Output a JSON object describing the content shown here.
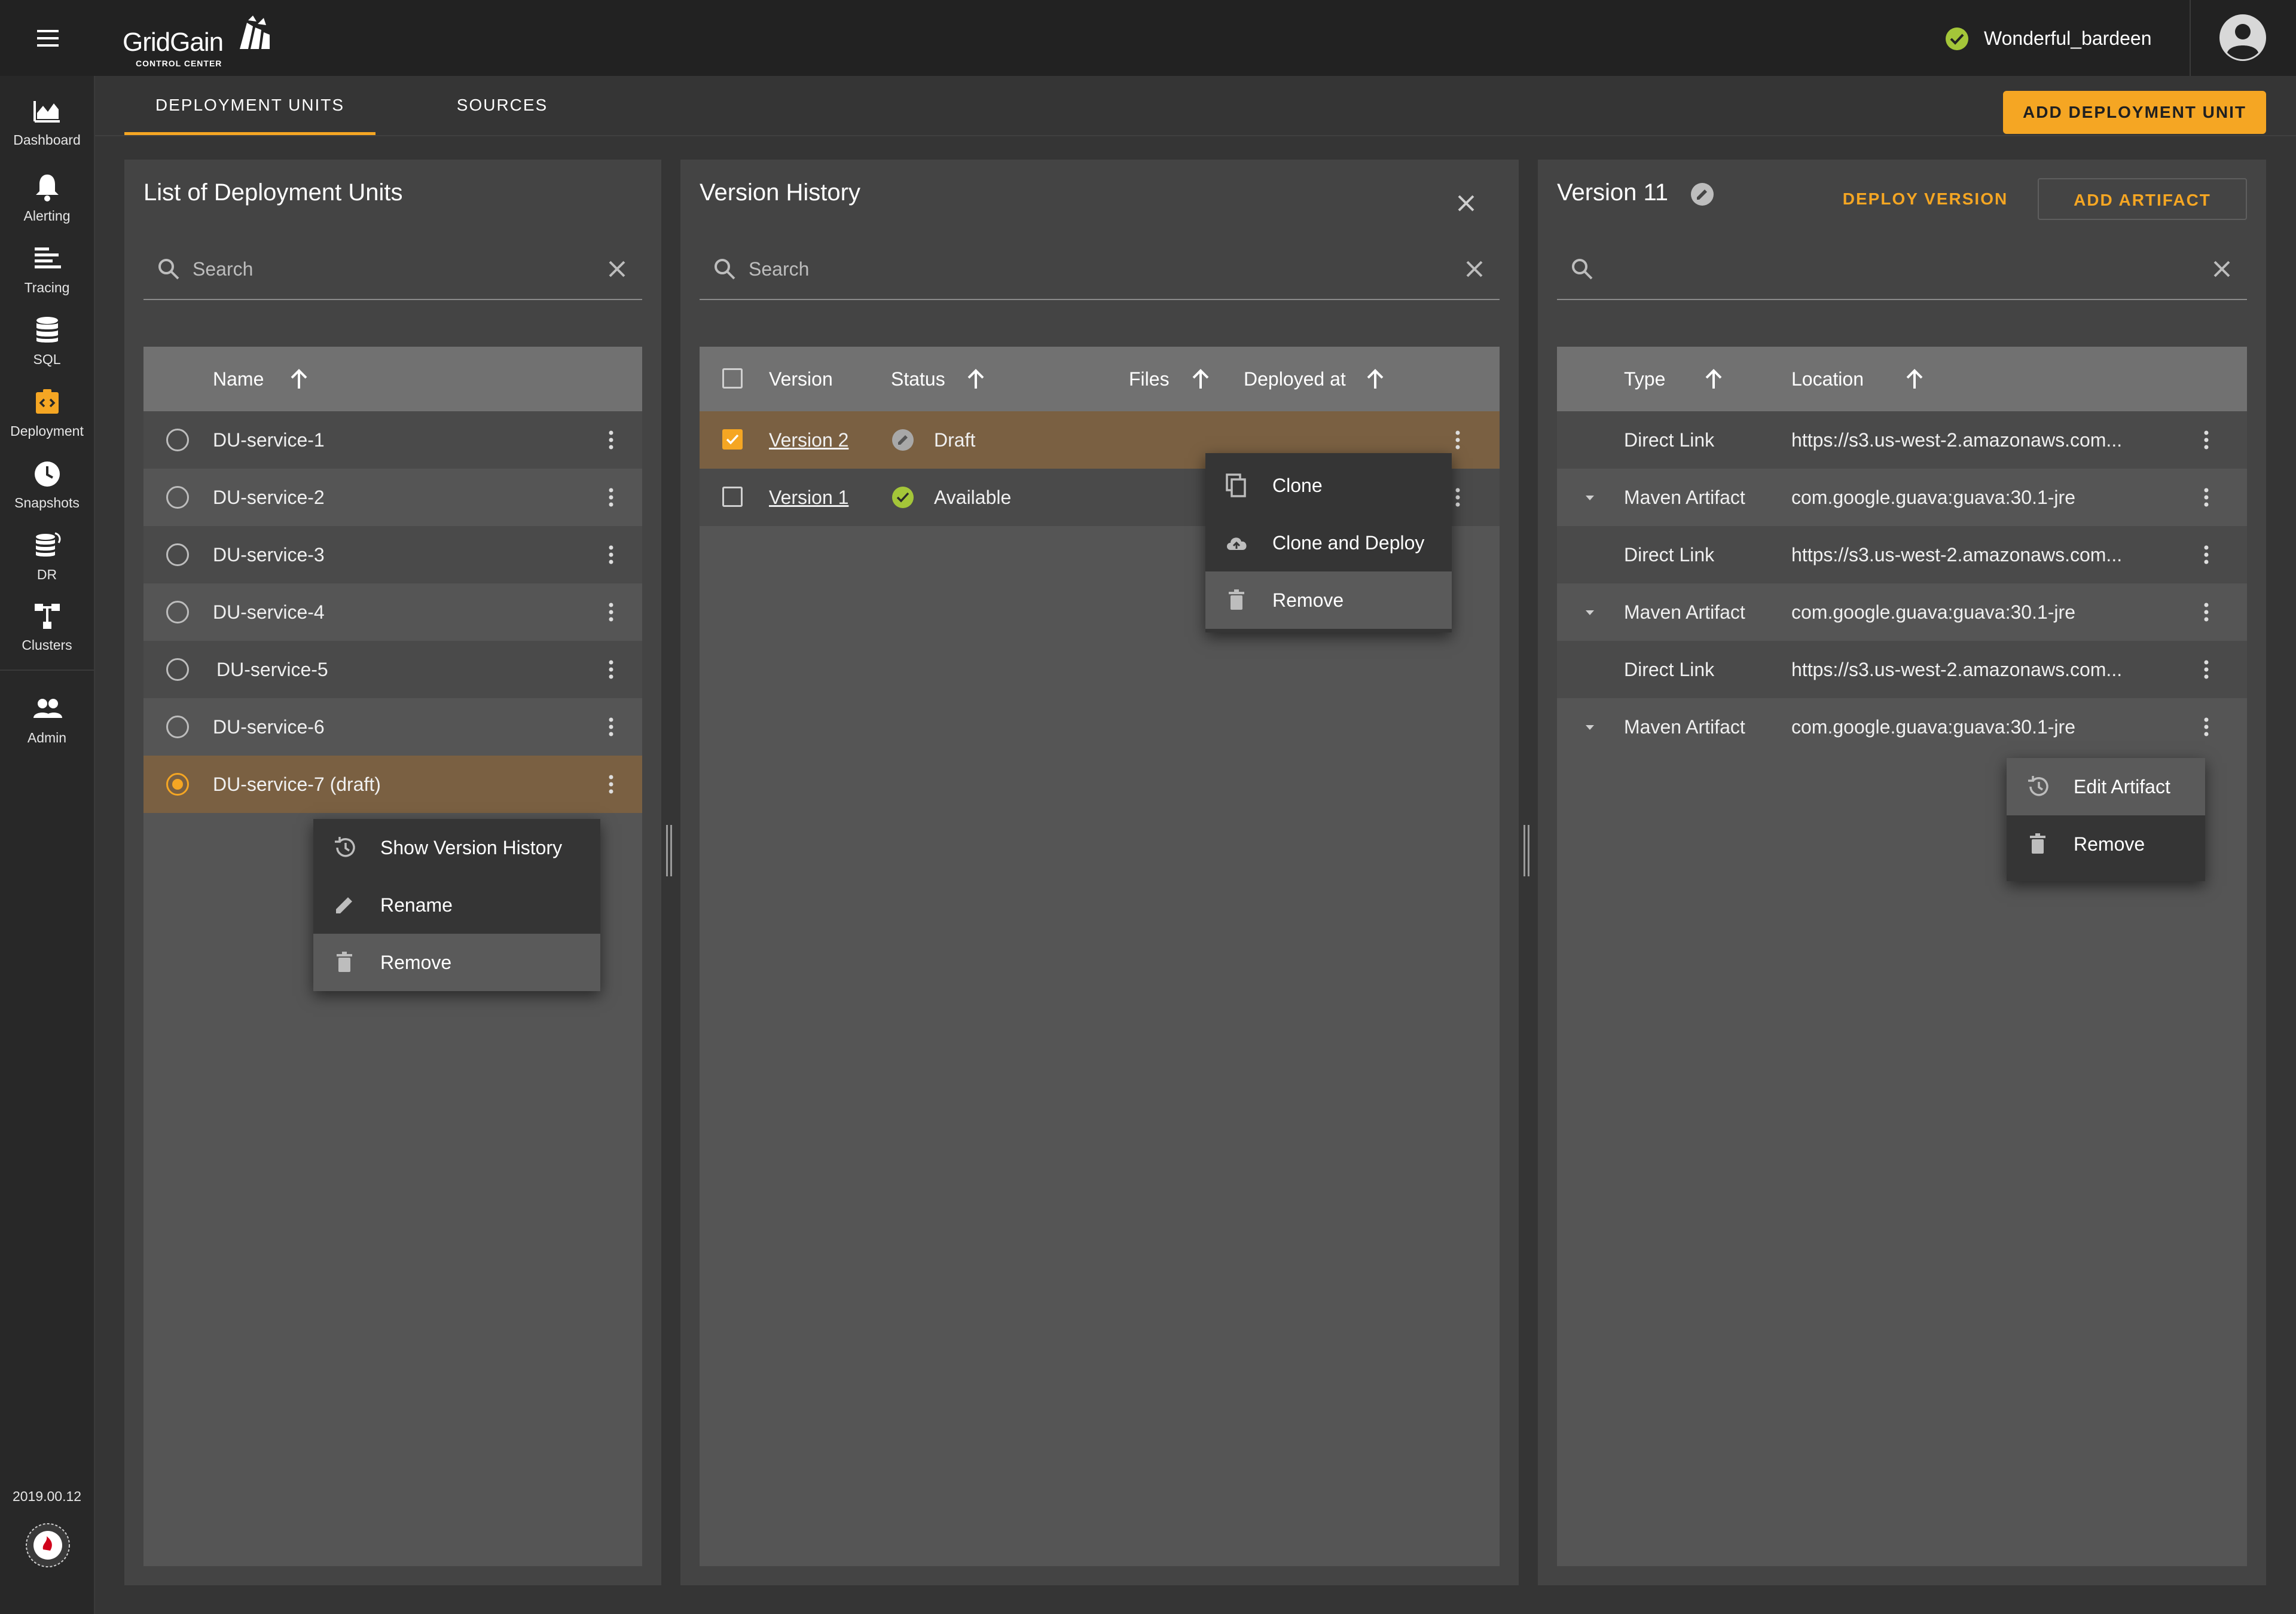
{
  "app": {
    "logo": "GridGain",
    "logo_sub": "CONTROL CENTER",
    "cluster_name": "Wonderful_bardeen",
    "version_date": "2019.00.12"
  },
  "sidebar": {
    "items": [
      {
        "label": "Dashboard",
        "icon": "chart-icon"
      },
      {
        "label": "Alerting",
        "icon": "bell-icon"
      },
      {
        "label": "Tracing",
        "icon": "tracing-icon"
      },
      {
        "label": "SQL",
        "icon": "database-icon"
      },
      {
        "label": "Deployment",
        "icon": "deployment-icon",
        "active": true
      },
      {
        "label": "Snapshots",
        "icon": "clock-icon"
      },
      {
        "label": "DR",
        "icon": "dr-icon"
      },
      {
        "label": "Clusters",
        "icon": "clusters-icon"
      },
      {
        "label": "Admin",
        "icon": "users-icon"
      }
    ]
  },
  "tabs": [
    {
      "label": "DEPLOYMENT UNITS",
      "active": true
    },
    {
      "label": "SOURCES",
      "active": false
    }
  ],
  "actions": {
    "add_deployment_unit": "ADD DEPLOYMENT UNIT"
  },
  "units_panel": {
    "title": "List of Deployment Units",
    "search_placeholder": "Search",
    "col_name": "Name",
    "rows": [
      {
        "name": "DU-service-1",
        "selected": false
      },
      {
        "name": "DU-service-2",
        "selected": false
      },
      {
        "name": "DU-service-3",
        "selected": false
      },
      {
        "name": "DU-service-4",
        "selected": false
      },
      {
        "name": "DU-service-5",
        "selected": false
      },
      {
        "name": "DU-service-6",
        "selected": false
      },
      {
        "name": "DU-service-7 (draft)",
        "selected": true
      }
    ],
    "menu": [
      {
        "label": "Show Version History",
        "icon": "history-icon"
      },
      {
        "label": "Rename",
        "icon": "pencil-icon"
      },
      {
        "label": "Remove",
        "icon": "trash-icon"
      }
    ]
  },
  "versions_panel": {
    "title": "Version History",
    "search_placeholder": "Search",
    "columns": {
      "version": "Version",
      "status": "Status",
      "files": "Files",
      "deployed_at": "Deployed at"
    },
    "rows": [
      {
        "version": "Version 2",
        "status": "Draft",
        "checked": true
      },
      {
        "version": "Version 1",
        "status": "Available",
        "checked": false
      }
    ],
    "menu": [
      {
        "label": "Clone",
        "icon": "copy-icon"
      },
      {
        "label": "Clone and Deploy",
        "icon": "cloud-upload-icon"
      },
      {
        "label": "Remove",
        "icon": "trash-icon"
      }
    ]
  },
  "version_panel": {
    "title": "Version 11",
    "deploy_version": "DEPLOY VERSION",
    "add_artifact": "ADD ARTIFACT",
    "search_placeholder": "",
    "columns": {
      "type": "Type",
      "location": "Location"
    },
    "rows": [
      {
        "type": "Direct Link",
        "location": "https://s3.us-west-2.amazonaws.com...",
        "expandable": false
      },
      {
        "type": "Maven Artifact",
        "location": "com.google.guava:guava:30.1-jre",
        "expandable": true
      },
      {
        "type": "Direct Link",
        "location": "https://s3.us-west-2.amazonaws.com...",
        "expandable": false
      },
      {
        "type": "Maven Artifact",
        "location": "com.google.guava:guava:30.1-jre",
        "expandable": true
      },
      {
        "type": "Direct Link",
        "location": "https://s3.us-west-2.amazonaws.com...",
        "expandable": false
      },
      {
        "type": "Maven Artifact",
        "location": "com.google.guava:guava:30.1-jre",
        "expandable": true
      }
    ],
    "menu": [
      {
        "label": "Edit Artifact",
        "icon": "history-icon"
      },
      {
        "label": "Remove",
        "icon": "trash-icon"
      }
    ]
  },
  "colors": {
    "accent": "#f5a623",
    "success": "#a4c639",
    "panel": "#444444",
    "selected_row": "#7a6042"
  }
}
